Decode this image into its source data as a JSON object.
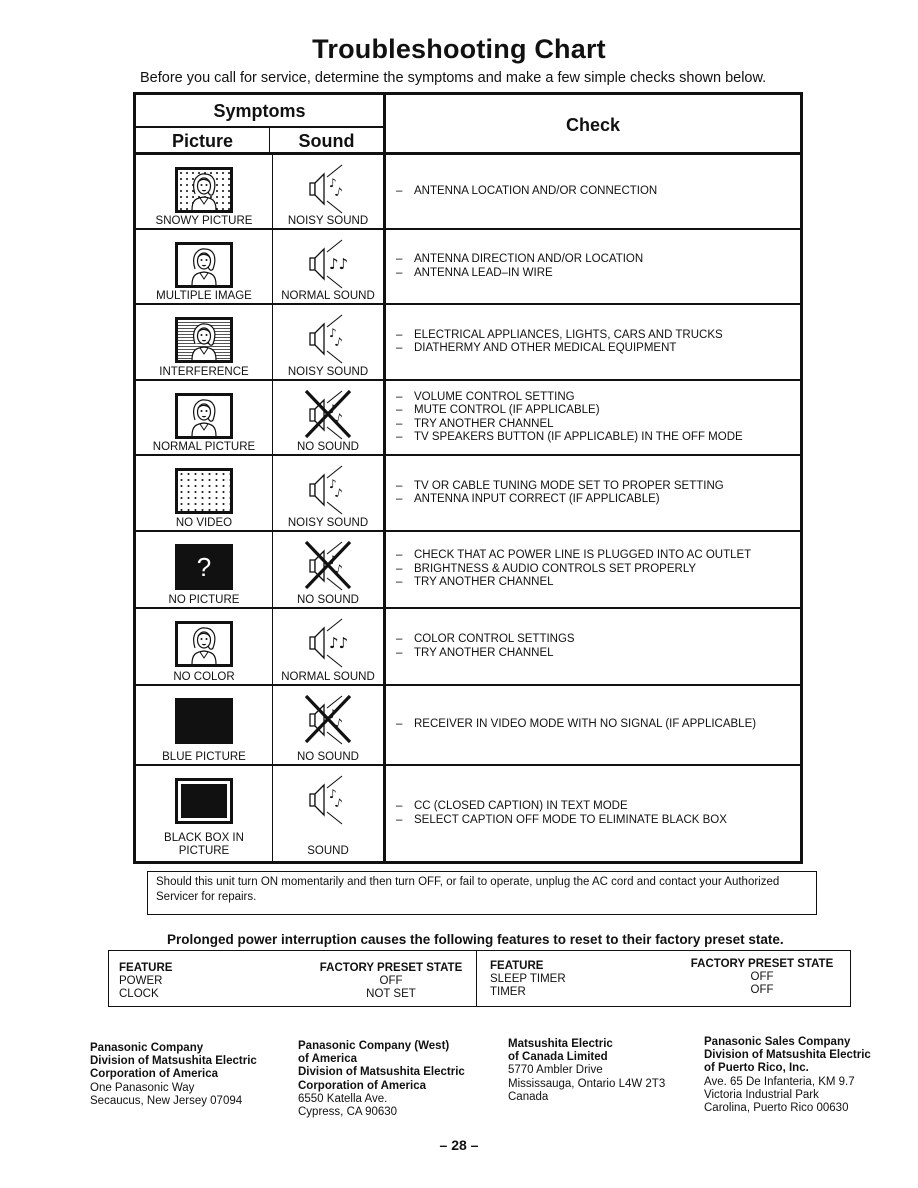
{
  "page": {
    "title": "Troubleshooting Chart",
    "subtitle": "Before you call for service, determine the symptoms and make a few simple checks shown below.",
    "page_number": "– 28 –"
  },
  "table": {
    "headers": {
      "symptoms": "Symptoms",
      "picture": "Picture",
      "sound": "Sound",
      "check": "Check"
    },
    "rows": [
      {
        "picture": "SNOWY PICTURE",
        "picture_icon": "tv-snowy-face-icon",
        "sound": "NOISY SOUND",
        "sound_icon": "speaker-noisy-icon",
        "checks": [
          "ANTENNA LOCATION AND/OR CONNECTION"
        ]
      },
      {
        "picture": "MULTIPLE IMAGE",
        "picture_icon": "tv-double-face-icon",
        "sound": "NORMAL SOUND",
        "sound_icon": "speaker-normal-icon",
        "checks": [
          "ANTENNA DIRECTION AND/OR LOCATION",
          "ANTENNA LEAD–IN WIRE"
        ]
      },
      {
        "picture": "INTERFERENCE",
        "picture_icon": "tv-lines-face-icon",
        "sound": "NOISY SOUND",
        "sound_icon": "speaker-noisy-icon",
        "checks": [
          "ELECTRICAL APPLIANCES, LIGHTS, CARS AND TRUCKS",
          "DIATHERMY AND OTHER MEDICAL EQUIPMENT"
        ]
      },
      {
        "picture": "NORMAL PICTURE",
        "picture_icon": "tv-face-icon",
        "sound": "NO SOUND",
        "sound_icon": "speaker-crossed-icon",
        "checks": [
          "VOLUME CONTROL SETTING",
          "MUTE CONTROL (IF APPLICABLE)",
          "TRY ANOTHER CHANNEL",
          "TV SPEAKERS BUTTON (IF APPLICABLE) IN THE OFF MODE"
        ]
      },
      {
        "picture": "NO VIDEO",
        "picture_icon": "tv-snow-only-icon",
        "sound": "NOISY SOUND",
        "sound_icon": "speaker-noisy-icon",
        "checks": [
          "TV OR CABLE TUNING MODE SET TO PROPER SETTING",
          "ANTENNA INPUT CORRECT (IF APPLICABLE)"
        ]
      },
      {
        "picture": "NO PICTURE",
        "picture_icon": "tv-question-icon",
        "sound": "NO SOUND",
        "sound_icon": "speaker-crossed-icon",
        "checks": [
          "CHECK THAT AC POWER LINE  IS PLUGGED  INTO AC OUTLET",
          "BRIGHTNESS & AUDIO CONTROLS SET PROPERLY",
          "TRY ANOTHER CHANNEL"
        ]
      },
      {
        "picture": "NO COLOR",
        "picture_icon": "tv-face-icon",
        "sound": "NORMAL SOUND",
        "sound_icon": "speaker-normal-icon",
        "checks": [
          "COLOR CONTROL SETTINGS",
          "TRY ANOTHER CHANNEL"
        ]
      },
      {
        "picture": "BLUE PICTURE",
        "picture_icon": "tv-solid-screen-icon",
        "sound": "NO SOUND",
        "sound_icon": "speaker-crossed-icon",
        "checks": [
          "RECEIVER IN VIDEO MODE WITH NO SIGNAL (IF APPLICABLE)"
        ]
      },
      {
        "picture": "BLACK BOX IN PICTURE",
        "picture_icon": "tv-black-box-icon",
        "sound": "SOUND",
        "sound_icon": "speaker-noisy-icon",
        "checks": [
          "CC (CLOSED CAPTION) IN TEXT MODE",
          "SELECT CAPTION OFF MODE TO ELIMINATE BLACK BOX"
        ]
      }
    ]
  },
  "note": "Should this unit turn ON momentarily and then turn OFF, or fail to operate, unplug the AC cord and contact your Authorized Servicer for repairs.",
  "reset": {
    "title": "Prolonged power interruption causes the following features to reset to their factory preset state.",
    "feature_header": "FEATURE",
    "state_header": "FACTORY PRESET STATE",
    "left": [
      {
        "feature": "POWER",
        "state": "OFF"
      },
      {
        "feature": "CLOCK",
        "state": "NOT SET"
      }
    ],
    "right": [
      {
        "feature": "SLEEP TIMER",
        "state": "OFF"
      },
      {
        "feature": "TIMER",
        "state": "OFF"
      }
    ]
  },
  "addresses": [
    {
      "bold": [
        "Panasonic Company",
        "Division of Matsushita Electric",
        "Corporation of America"
      ],
      "plain": [
        "One Panasonic Way",
        "Secaucus, New Jersey 07094"
      ]
    },
    {
      "bold": [
        "Panasonic Company (West)",
        "of America",
        "Division of Matsushita Electric",
        "Corporation of America"
      ],
      "plain": [
        "6550 Katella Ave.",
        "Cypress, CA 90630"
      ]
    },
    {
      "bold": [
        "Matsushita Electric",
        "of Canada Limited"
      ],
      "plain": [
        "5770 Ambler Drive",
        "Mississauga, Ontario L4W 2T3",
        "Canada"
      ]
    },
    {
      "bold": [
        "Panasonic Sales Company",
        "Division of Matsushita Electric",
        "of Puerto Rico, Inc."
      ],
      "plain": [
        "Ave. 65 De Infanteria, KM 9.7",
        "Victoria Industrial Park",
        "Carolina, Puerto Rico 00630"
      ]
    }
  ]
}
